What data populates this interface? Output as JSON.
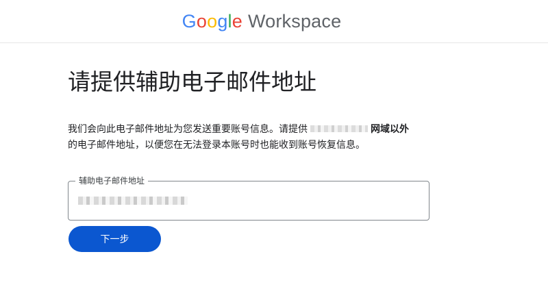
{
  "header": {
    "logo": {
      "google_letters": [
        "G",
        "o",
        "o",
        "g",
        "l",
        "e"
      ],
      "google_colors": [
        "#4285F4",
        "#EA4335",
        "#FBBC05",
        "#4285F4",
        "#34A853",
        "#EA4335"
      ],
      "product": "Workspace"
    }
  },
  "main": {
    "title": "请提供辅助电子邮件地址",
    "description": {
      "part1": "我们会向此电子邮件地址为您发送重要账号信息。请提供",
      "domain_bold": "网域以外",
      "part2": "的电子邮件地址，以便您在无法登录本账号时也能收到账号恢复信息。"
    },
    "email_field": {
      "label": "辅助电子邮件地址",
      "value": ""
    },
    "next_button": "下一步"
  },
  "colors": {
    "primary": "#0b57d0",
    "border": "#80868b"
  }
}
